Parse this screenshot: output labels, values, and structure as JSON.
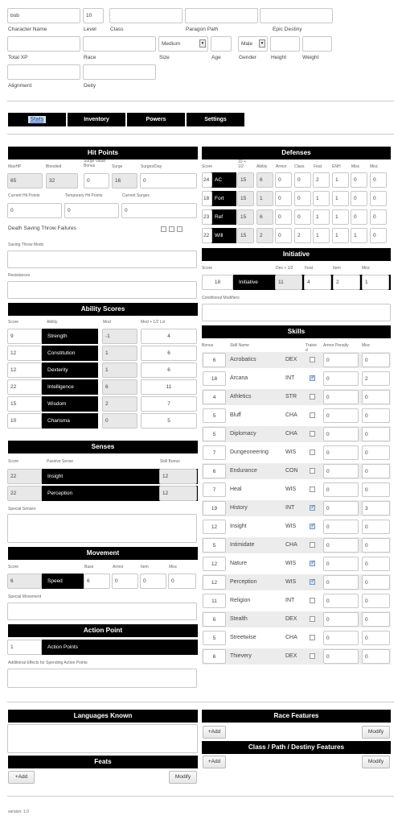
{
  "character": {
    "name": "bob",
    "level": "10",
    "class": "",
    "paragon_path": "",
    "epic_destiny": "",
    "labels": {
      "name": "Character Name",
      "level": "Level",
      "class": "Class",
      "paragon": "Paragon Path",
      "epic": "Epic Destiny"
    },
    "total_xp": "",
    "race": "",
    "size": "Medium",
    "age": "",
    "gender": "Male",
    "height": "",
    "weight": "",
    "labels2": {
      "total_xp": "Total XP",
      "race": "Race",
      "size": "Size",
      "age": "Age",
      "gender": "Gender",
      "height": "Height",
      "weight": "Weight"
    },
    "alignment": "",
    "deity": "",
    "labels3": {
      "alignment": "Alignment",
      "deity": "Deity"
    }
  },
  "tabs": [
    "Stats",
    "Inventory",
    "Powers",
    "Settings"
  ],
  "hit_points": {
    "title": "Hit Points",
    "headers": [
      "MaxHP",
      "Bloodied",
      "Surge Value Bonus",
      "Surge",
      "Surges/Day"
    ],
    "values": [
      "65",
      "32",
      "0",
      "16",
      "0"
    ],
    "headers2": [
      "Current Hit Points",
      "Temporary Hit Points",
      "Current Surges"
    ],
    "values2": [
      "0",
      "0",
      "0"
    ],
    "death_saves": "Death Saving Throw Failures",
    "saving_mods": "Saving Throw Mods",
    "resistances": "Resistances"
  },
  "ability_scores": {
    "title": "Ability Scores",
    "headers": [
      "Score",
      "Ability",
      "Mod",
      "Mod + 1/2 Lvl"
    ],
    "rows": [
      {
        "score": "9",
        "name": "Strength",
        "mod": "-1",
        "half": "4"
      },
      {
        "score": "12",
        "name": "Constitution",
        "mod": "1",
        "half": "6"
      },
      {
        "score": "12",
        "name": "Dexterity",
        "mod": "1",
        "half": "6"
      },
      {
        "score": "22",
        "name": "Intelligence",
        "mod": "6",
        "half": "11"
      },
      {
        "score": "15",
        "name": "Wisdom",
        "mod": "2",
        "half": "7"
      },
      {
        "score": "10",
        "name": "Charisma",
        "mod": "0",
        "half": "5"
      }
    ]
  },
  "senses": {
    "title": "Senses",
    "headers": [
      "Score",
      "Passive Sense",
      "Skill Bonus"
    ],
    "rows": [
      {
        "score": "22",
        "name": "Insight",
        "bonus": "12"
      },
      {
        "score": "22",
        "name": "Perception",
        "bonus": "12"
      }
    ],
    "special": "Special Senses"
  },
  "movement": {
    "title": "Movement",
    "headers": [
      "Score",
      "Base",
      "Armor",
      "Item",
      "Misc"
    ],
    "score": "6",
    "name": "Speed",
    "base": "6",
    "armor": "0",
    "item": "0",
    "misc": "0",
    "special": "Special Movement"
  },
  "action_point": {
    "title": "Action Point",
    "value": "1",
    "name": "Action Points",
    "effects": "Additional Effects for Spending Action Points"
  },
  "defenses": {
    "title": "Defenses",
    "headers": [
      "Score",
      "10 + 1/2",
      "Ability",
      "Armor",
      "Class",
      "Feat",
      "ENH",
      "Misc",
      "Misc"
    ],
    "rows": [
      {
        "score": "24",
        "name": "AC",
        "v": [
          "15",
          "6",
          "0",
          "0",
          "2",
          "1",
          "0",
          "0"
        ]
      },
      {
        "score": "18",
        "name": "Fort",
        "v": [
          "15",
          "1",
          "0",
          "0",
          "1",
          "1",
          "0",
          "0"
        ]
      },
      {
        "score": "23",
        "name": "Ref",
        "v": [
          "15",
          "6",
          "0",
          "0",
          "1",
          "1",
          "0",
          "0"
        ]
      },
      {
        "score": "22",
        "name": "Will",
        "v": [
          "15",
          "2",
          "0",
          "2",
          "1",
          "1",
          "1",
          "0"
        ]
      }
    ]
  },
  "initiative": {
    "title": "Initiative",
    "headers": [
      "Score",
      "Dex + 1/2",
      "Feat",
      "Item",
      "Misc"
    ],
    "score": "18",
    "name": "Initiative",
    "dex": "11",
    "feat": "4",
    "item": "2",
    "misc": "1",
    "conditional": "Conditional Modifiers"
  },
  "skills": {
    "title": "Skills",
    "headers": [
      "Bonus",
      "Skill Name",
      "Traine d",
      "Armor Penalty",
      "Misc"
    ],
    "rows": [
      {
        "bonus": "6",
        "name": "Acrobatics",
        "ab": "DEX",
        "trained": false,
        "armor": "0",
        "misc": "0",
        "hl": true
      },
      {
        "bonus": "18",
        "name": "Arcana",
        "ab": "INT",
        "trained": true,
        "armor": "0",
        "misc": "2",
        "hl": false
      },
      {
        "bonus": "4",
        "name": "Athletics",
        "ab": "STR",
        "trained": false,
        "armor": "0",
        "misc": "0",
        "hl": true
      },
      {
        "bonus": "5",
        "name": "Bluff",
        "ab": "CHA",
        "trained": false,
        "armor": "0",
        "misc": "0",
        "hl": false
      },
      {
        "bonus": "5",
        "name": "Diplomacy",
        "ab": "CHA",
        "trained": false,
        "armor": "0",
        "misc": "0",
        "hl": true
      },
      {
        "bonus": "7",
        "name": "Dungeoneering",
        "ab": "WIS",
        "trained": false,
        "armor": "0",
        "misc": "0",
        "hl": false
      },
      {
        "bonus": "6",
        "name": "Endurance",
        "ab": "CON",
        "trained": false,
        "armor": "0",
        "misc": "0",
        "hl": true
      },
      {
        "bonus": "7",
        "name": "Heal",
        "ab": "WIS",
        "trained": false,
        "armor": "0",
        "misc": "0",
        "hl": false
      },
      {
        "bonus": "19",
        "name": "History",
        "ab": "INT",
        "trained": true,
        "armor": "0",
        "misc": "3",
        "hl": true
      },
      {
        "bonus": "12",
        "name": "Insight",
        "ab": "WIS",
        "trained": true,
        "armor": "0",
        "misc": "0",
        "hl": false
      },
      {
        "bonus": "5",
        "name": "Intimidate",
        "ab": "CHA",
        "trained": false,
        "armor": "0",
        "misc": "0",
        "hl": true
      },
      {
        "bonus": "12",
        "name": "Nature",
        "ab": "WIS",
        "trained": true,
        "armor": "0",
        "misc": "0",
        "hl": false
      },
      {
        "bonus": "12",
        "name": "Perception",
        "ab": "WIS",
        "trained": true,
        "armor": "0",
        "misc": "0",
        "hl": true
      },
      {
        "bonus": "11",
        "name": "Religion",
        "ab": "INT",
        "trained": false,
        "armor": "0",
        "misc": "0",
        "hl": false
      },
      {
        "bonus": "6",
        "name": "Stealth",
        "ab": "DEX",
        "trained": false,
        "armor": "0",
        "misc": "0",
        "hl": true
      },
      {
        "bonus": "5",
        "name": "Streetwise",
        "ab": "CHA",
        "trained": false,
        "armor": "0",
        "misc": "0",
        "hl": false
      },
      {
        "bonus": "6",
        "name": "Thievery",
        "ab": "DEX",
        "trained": false,
        "armor": "0",
        "misc": "0",
        "hl": true
      }
    ]
  },
  "languages": {
    "title": "Languages Known"
  },
  "feats": {
    "title": "Feats",
    "add": "+Add",
    "modify": "Modify"
  },
  "race_features": {
    "title": "Race Features",
    "add": "+Add",
    "modify": "Modify"
  },
  "class_features": {
    "title": "Class / Path / Destiny Features",
    "add": "+Add",
    "modify": "Modify"
  },
  "footer": {
    "version": "version: 1.0"
  },
  "colors": {
    "bar": "#000000",
    "tab_active_text": "#1f5aa6",
    "row_highlight": "#ececec"
  }
}
